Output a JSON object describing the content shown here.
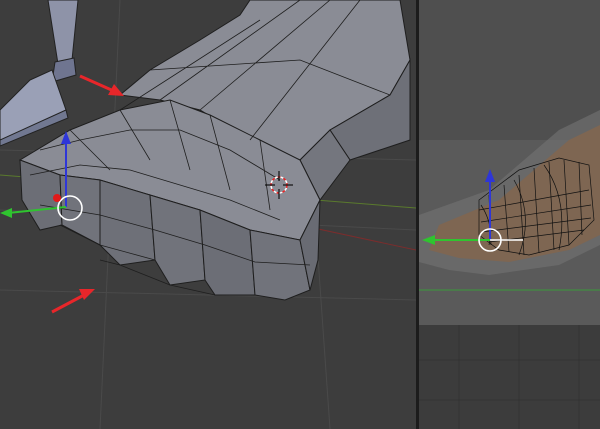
{
  "app": {
    "name": "",
    "left_view_label": "",
    "right_view_label": ""
  },
  "colors": {
    "viewport_bg": "#3d3d3d",
    "mesh_face": "#7b7d86",
    "mesh_edge": "#1e1e1e",
    "axis_x": "#c33a3a",
    "axis_y": "#2fc42f",
    "axis_z": "#2e36d8",
    "annotation_arrow": "#e8262a",
    "skin_reference": "#7e6652"
  },
  "icons": {
    "transform_manipulator": "circle-widget",
    "cursor_3d": "crosshair-3d-cursor",
    "annotation": "red-arrow-icon"
  }
}
